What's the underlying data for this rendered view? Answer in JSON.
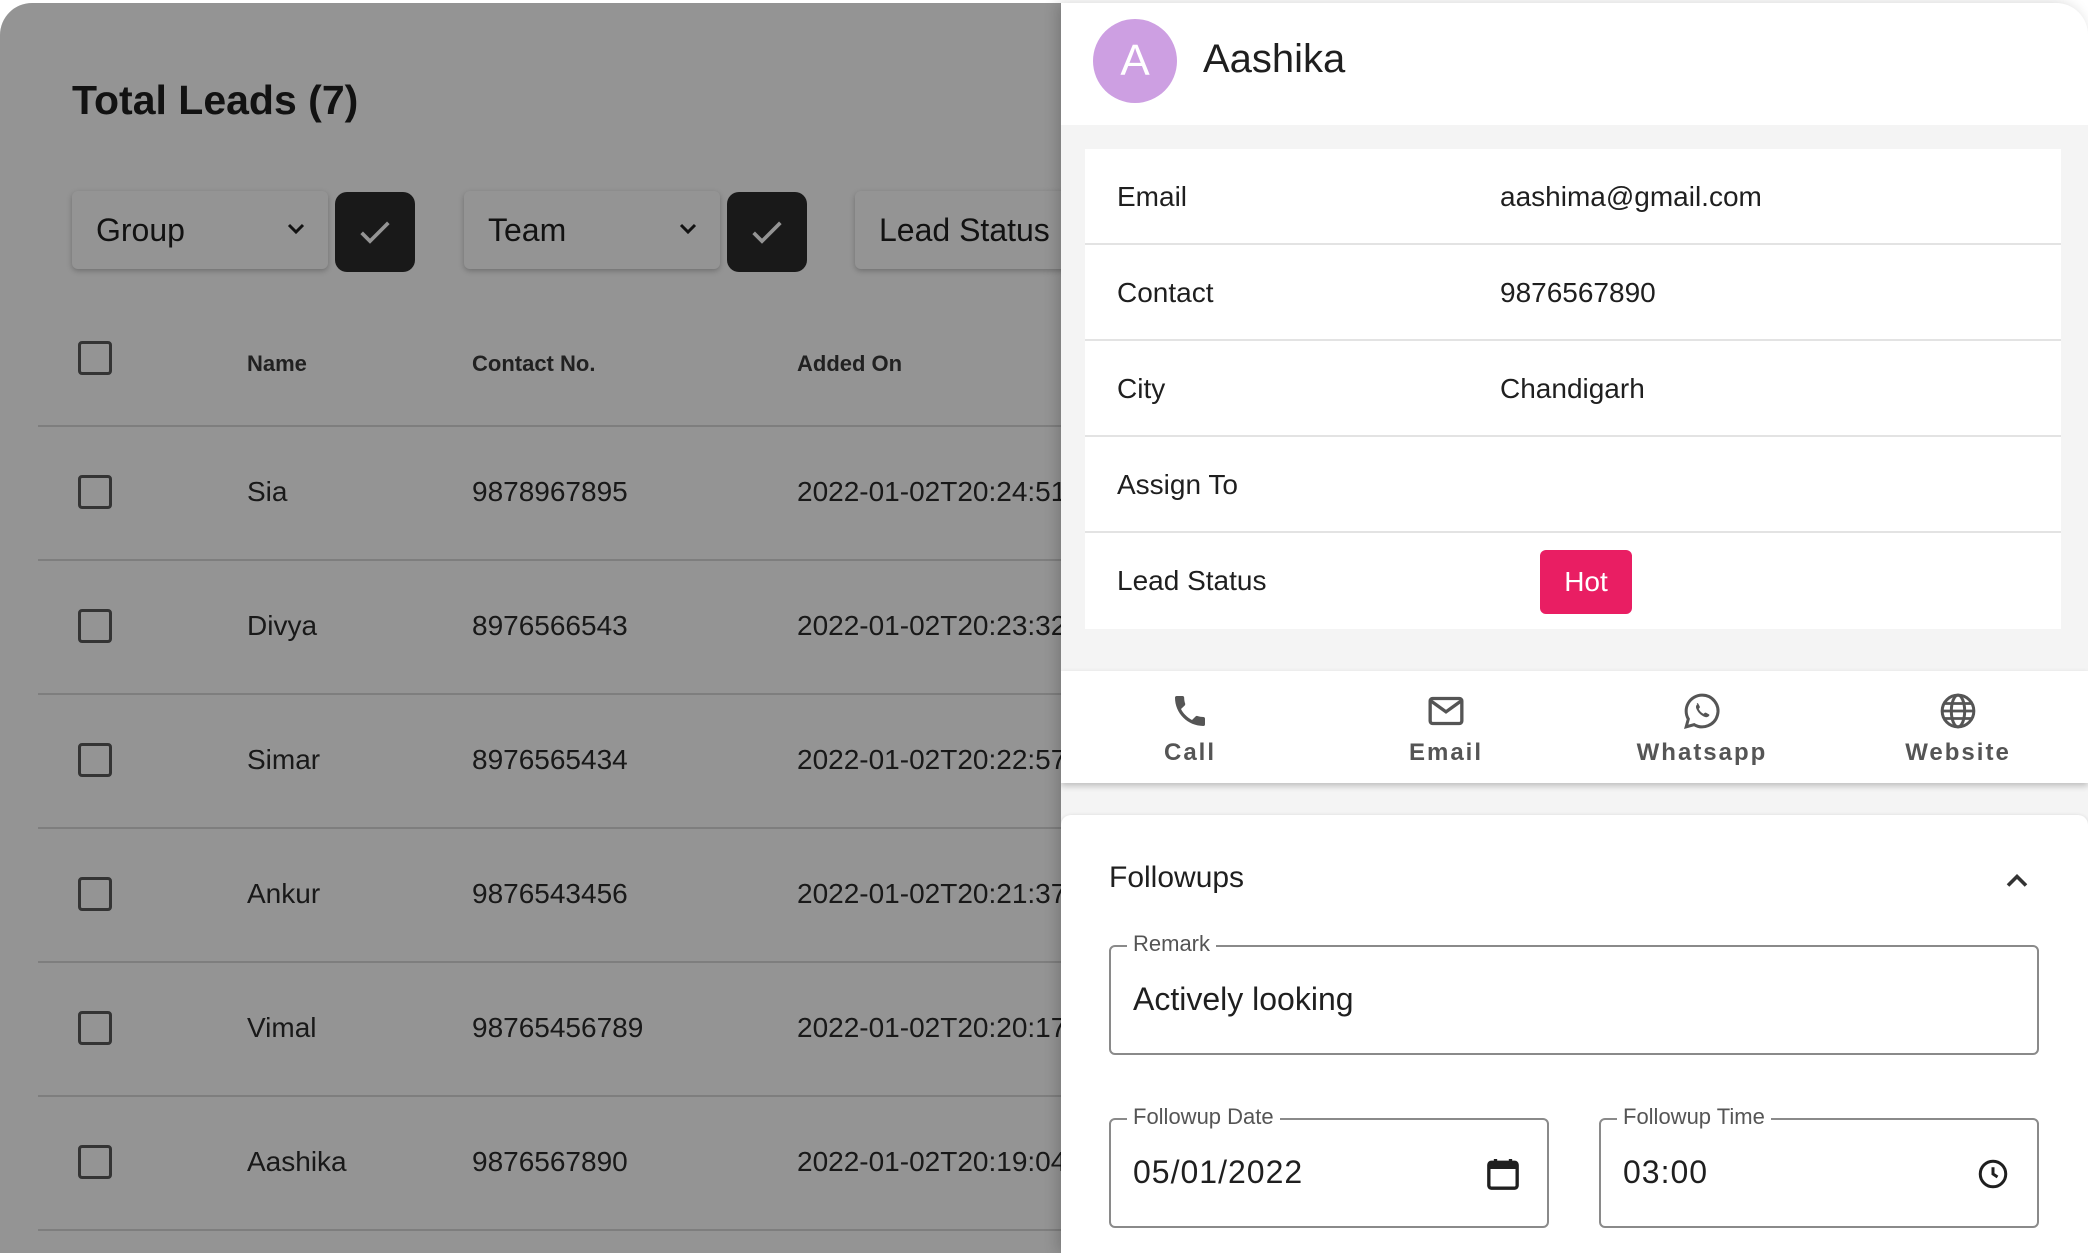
{
  "page": {
    "title": "Total Leads (7)",
    "filters": [
      {
        "label": "Group"
      },
      {
        "label": "Team"
      },
      {
        "label": "Lead Status"
      }
    ],
    "table": {
      "headers": [
        "Name",
        "Contact No.",
        "Added On"
      ],
      "rows": [
        {
          "name": "Sia",
          "contact": "9878967895",
          "added": "2022-01-02T20:24:51"
        },
        {
          "name": "Divya",
          "contact": "8976566543",
          "added": "2022-01-02T20:23:32"
        },
        {
          "name": "Simar",
          "contact": "8976565434",
          "added": "2022-01-02T20:22:57"
        },
        {
          "name": "Ankur",
          "contact": "9876543456",
          "added": "2022-01-02T20:21:37"
        },
        {
          "name": "Vimal",
          "contact": "98765456789",
          "added": "2022-01-02T20:20:17"
        },
        {
          "name": "Aashika",
          "contact": "9876567890",
          "added": "2022-01-02T20:19:04"
        }
      ]
    }
  },
  "drawer": {
    "avatar_letter": "A",
    "avatar_color": "#cd9fe2",
    "name": "Aashika",
    "details": [
      {
        "label": "Email",
        "value": "aashima@gmail.com"
      },
      {
        "label": "Contact",
        "value": "9876567890"
      },
      {
        "label": "City",
        "value": "Chandigarh"
      },
      {
        "label": "Assign To",
        "value": ""
      }
    ],
    "lead_status": {
      "label": "Lead Status",
      "value": "Hot",
      "color": "#e91e63"
    },
    "actions": [
      {
        "label": "Call",
        "icon": "phone-icon"
      },
      {
        "label": "Email",
        "icon": "mail-icon"
      },
      {
        "label": "Whatsapp",
        "icon": "whatsapp-icon"
      },
      {
        "label": "Website",
        "icon": "globe-icon"
      }
    ],
    "followups": {
      "title": "Followups",
      "remark": {
        "label": "Remark",
        "value": "Actively looking"
      },
      "date": {
        "label": "Followup Date",
        "value": "05/01/2022"
      },
      "time": {
        "label": "Followup Time",
        "value": "03:00"
      }
    }
  }
}
